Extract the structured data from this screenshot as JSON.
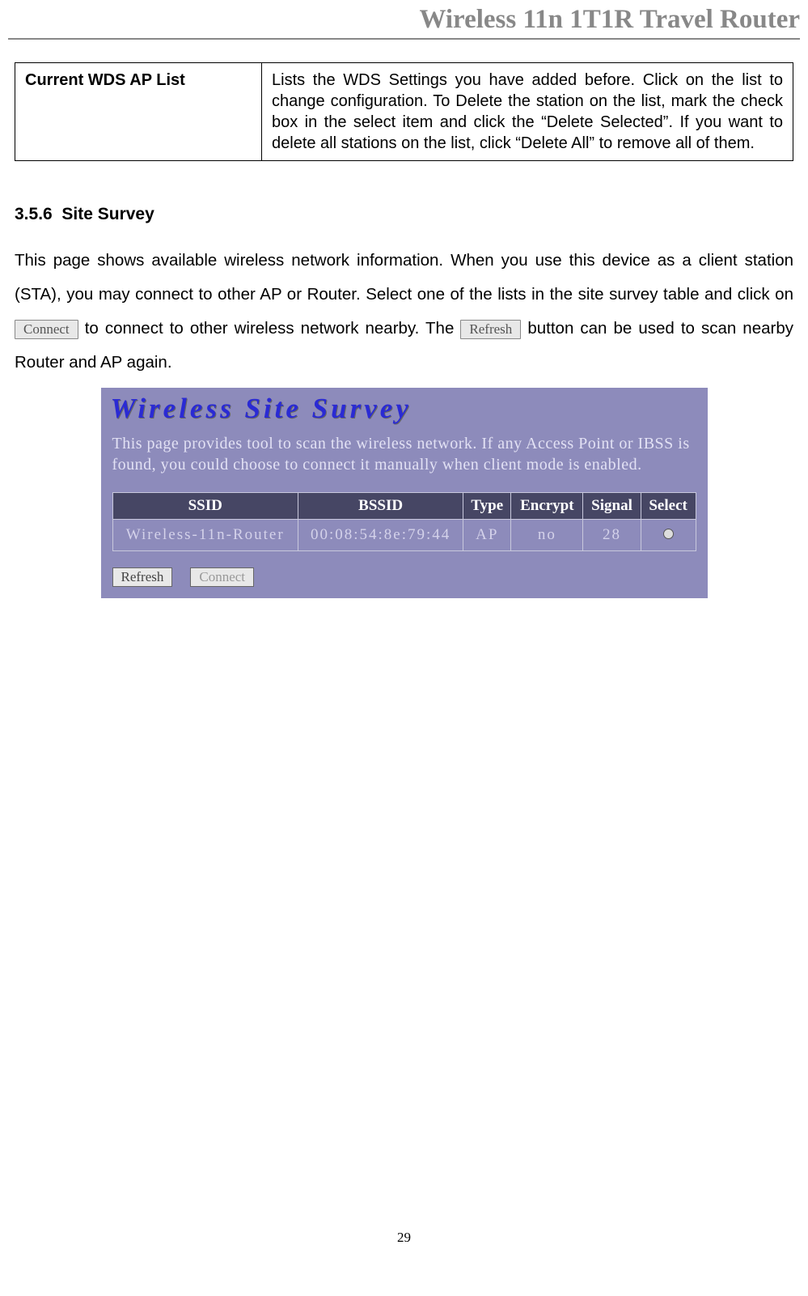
{
  "header": {
    "title": "Wireless 11n 1T1R Travel Router"
  },
  "wds_row": {
    "label": "Current WDS AP List",
    "desc": "Lists the WDS Settings you have added before. Click on the list to change configuration. To Delete the station on the list, mark the check box in the select item and click the “Delete Selected”. If you want to delete all stations on the list, click “Delete All” to remove all of them."
  },
  "section": {
    "number": "3.5.6",
    "title": "Site Survey"
  },
  "body": {
    "p1a": "This page shows available wireless network information. When you use this device as a client station (STA), you may connect to other AP or Router. Select one of the lists in the site survey table and click on ",
    "p1b": " to connect to other wireless network nearby. The ",
    "p1c": " button can be used to scan nearby Router and AP again."
  },
  "inline_buttons": {
    "connect": "Connect",
    "refresh": "Refresh"
  },
  "screenshot": {
    "title": "Wireless Site Survey",
    "desc": "This page provides tool to scan the wireless network. If any Access Point or IBSS is found, you could choose to connect it manually when client mode is enabled.",
    "columns": {
      "ssid": "SSID",
      "bssid": "BSSID",
      "type": "Type",
      "encrypt": "Encrypt",
      "signal": "Signal",
      "select": "Select"
    },
    "row": {
      "ssid": "Wireless-11n-Router",
      "bssid": "00:08:54:8e:79:44",
      "type": "AP",
      "encrypt": "no",
      "signal": "28"
    },
    "buttons": {
      "refresh": "Refresh",
      "connect": "Connect"
    }
  },
  "page_number": "29"
}
